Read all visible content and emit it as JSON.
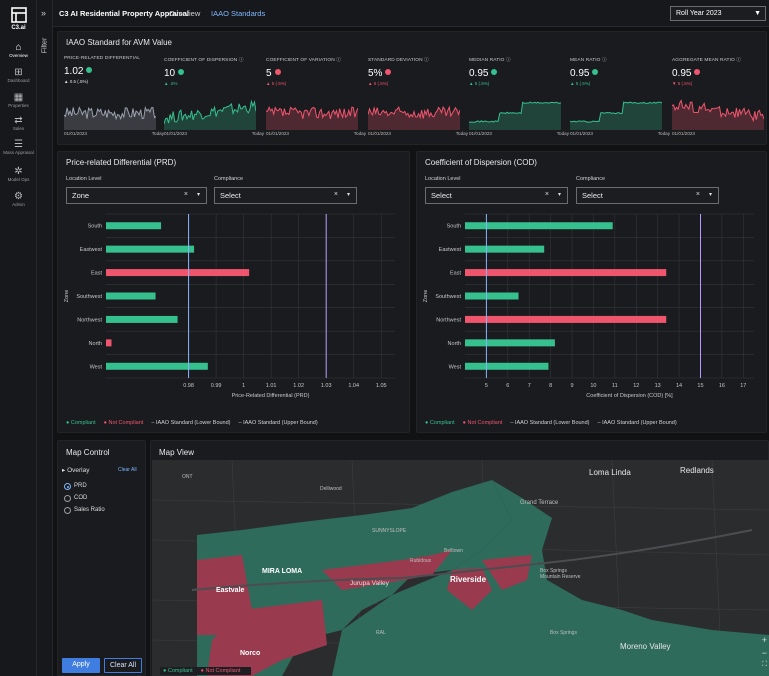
{
  "nav": {
    "logo_label": "C3.ai",
    "items": [
      {
        "label": "Overview",
        "icon": "home-icon"
      },
      {
        "label": "Dashboard",
        "icon": "grid-icon"
      },
      {
        "label": "Properties",
        "icon": "building-icon"
      },
      {
        "label": "Sales",
        "icon": "arrows-icon"
      },
      {
        "label": "Mass Appraisal",
        "icon": "list-icon"
      },
      {
        "label": "Model Ops",
        "icon": "cog-icon"
      },
      {
        "label": "Admin",
        "icon": "gear-icon"
      }
    ]
  },
  "filter": {
    "label": "Filter",
    "chevron": "»"
  },
  "topbar": {
    "title": "C3 AI Residential Property Appraisal",
    "tabs": [
      "Overview",
      "IAAO Standards"
    ],
    "active_tab": "IAAO Standards",
    "roll_year": "Roll Year 2023"
  },
  "iaao": {
    "title": "IAAO Standard for AVM Value",
    "kpis": [
      {
        "label": "PRICE-RELATED DIFFERENTIAL",
        "value": "1.02",
        "status": "ok",
        "delta": "▲ 0.5 (.5%)",
        "delta_dir": "wh",
        "start": "01/01/2023",
        "end": "Today",
        "color": "#9aa0ad"
      },
      {
        "label": "COEFFICIENT OF DISPERSION ⓘ",
        "value": "10",
        "status": "ok",
        "delta": "▲ .5%",
        "delta_dir": "up",
        "start": "01/01/2023",
        "end": "Today",
        "color": "#35c08e"
      },
      {
        "label": "COEFFICIENT OF VARIATION ⓘ",
        "value": "5",
        "status": "bad",
        "delta": "▲ 5 (.5%)",
        "delta_dir": "dn",
        "start": "01/01/2023",
        "end": "Today",
        "color": "#f0556e"
      },
      {
        "label": "STANDARD DEVIATION ⓘ",
        "value": "5%",
        "status": "bad",
        "delta": "▲ 5 (.5%)",
        "delta_dir": "dn",
        "start": "01/01/2023",
        "end": "Today",
        "color": "#f0556e"
      },
      {
        "label": "MEDIAN RATIO ⓘ",
        "value": "0.95",
        "status": "ok",
        "delta": "▲ 5 (.5%)",
        "delta_dir": "up",
        "start": "01/01/2023",
        "end": "Today",
        "color": "#35c08e"
      },
      {
        "label": "MEAN RATIO ⓘ",
        "value": "0.95",
        "status": "ok",
        "delta": "▲ 5 (.5%)",
        "delta_dir": "up",
        "start": "01/01/2023",
        "end": "Today",
        "color": "#35c08e"
      },
      {
        "label": "AGGREGATE MEAN RATIO ⓘ",
        "value": "0.95",
        "status": "bad",
        "delta": "▼ 5 (.5%)",
        "delta_dir": "dn",
        "start": "01/01/2023",
        "end": "",
        "color": "#f0556e"
      }
    ]
  },
  "prd": {
    "title": "Price-related Differential (PRD)",
    "location_label": "Location Level",
    "location_value": "Zone",
    "compliance_label": "Compliance",
    "compliance_value": "Select",
    "clear_glyph": "×",
    "caret_glyph": "▾"
  },
  "cod": {
    "title": "Coefficient of Dispersion (COD)",
    "location_label": "Location Level",
    "location_value": "Select",
    "compliance_label": "Compliance",
    "compliance_value": "Select",
    "clear_glyph": "×",
    "caret_glyph": "▾"
  },
  "legend": {
    "compliant": "● Compliant",
    "not_compliant": "● Not Compliant",
    "lower": "– IAAO Standard (Lower Bound)",
    "upper": "– IAAO Standard (Upper Bound)"
  },
  "chart_data": [
    {
      "type": "bar",
      "orientation": "horizontal",
      "title": "",
      "ylabel": "Zone",
      "xlabel": "Price-Related Differential (PRD)",
      "categories": [
        "South",
        "Eastwest",
        "East",
        "Southwest",
        "Northwest",
        "North",
        "West"
      ],
      "values": [
        0.97,
        0.982,
        1.002,
        0.968,
        0.976,
        0.952,
        0.987
      ],
      "status": [
        "Compliant",
        "Compliant",
        "Not Compliant",
        "Compliant",
        "Compliant",
        "Not Compliant",
        "Compliant"
      ],
      "xlim": [
        0.95,
        1.055
      ],
      "xticks": [
        "0.98",
        "0.99",
        "1",
        "1.01",
        "1.02",
        "1.03",
        "1.04",
        "1.05"
      ],
      "xtick_values": [
        0.98,
        0.99,
        1.0,
        1.01,
        1.02,
        1.03,
        1.04,
        1.05
      ],
      "lower_bound": 0.98,
      "upper_bound": 1.03,
      "colors": {
        "compliant": "#35c08e",
        "not_compliant": "#f0556e",
        "lower": "#8ab4ff",
        "upper": "#b99cff"
      }
    },
    {
      "type": "bar",
      "orientation": "horizontal",
      "title": "",
      "ylabel": "Zone",
      "xlabel": "Coefficient of Dispersion (COD) [%]",
      "categories": [
        "South",
        "Eastwest",
        "East",
        "Southwest",
        "Northwest",
        "North",
        "West"
      ],
      "values": [
        10.9,
        7.7,
        13.4,
        6.5,
        13.4,
        8.2,
        7.9
      ],
      "status": [
        "Compliant",
        "Compliant",
        "Not Compliant",
        "Compliant",
        "Not Compliant",
        "Compliant",
        "Compliant"
      ],
      "xlim": [
        4,
        17.5
      ],
      "xticks": [
        "5",
        "6",
        "7",
        "8",
        "9",
        "10",
        "11",
        "12",
        "13",
        "14",
        "15",
        "16",
        "17"
      ],
      "xtick_values": [
        5,
        6,
        7,
        8,
        9,
        10,
        11,
        12,
        13,
        14,
        15,
        16,
        17
      ],
      "lower_bound": 5,
      "upper_bound": 15,
      "colors": {
        "compliant": "#35c08e",
        "not_compliant": "#f0556e",
        "lower": "#8ab4ff",
        "upper": "#b99cff"
      }
    }
  ],
  "map_control": {
    "title": "Map Control",
    "overlay": "▸ Overlay",
    "clear_all_link": "Clear All",
    "options": [
      "PRD",
      "COD",
      "Sales Ratio"
    ],
    "selected": "PRD",
    "apply": "Apply",
    "clear_all": "Clear All"
  },
  "map": {
    "title": "Map View",
    "labels": {
      "loma_linda": "Loma Linda",
      "redlands": "Redlands",
      "grand_terrace": "Grand Terrace",
      "mira_loma": "MIRA LOMA",
      "eastvale": "Eastvale",
      "jurupa_valley": "Jurupa Valley",
      "riverside": "Riverside",
      "norco": "Norco",
      "moreno_valley": "Moreno Valley",
      "ont": "ONT",
      "ral": "RAL",
      "box_springs_reserve": "Box Springs\nMountain Reserve",
      "box_springs": "Box Springs",
      "sunnyslope": "SUNNYSLOPE",
      "delliwood": "Delliwood",
      "belltown": "Belltown",
      "rubidoux": "Rubidoux"
    },
    "legend_compliant": "● Compliant",
    "legend_not_compliant": "● Not Compliant",
    "zoom_in": "+",
    "zoom_out": "−",
    "fullscreen": "⛶"
  }
}
